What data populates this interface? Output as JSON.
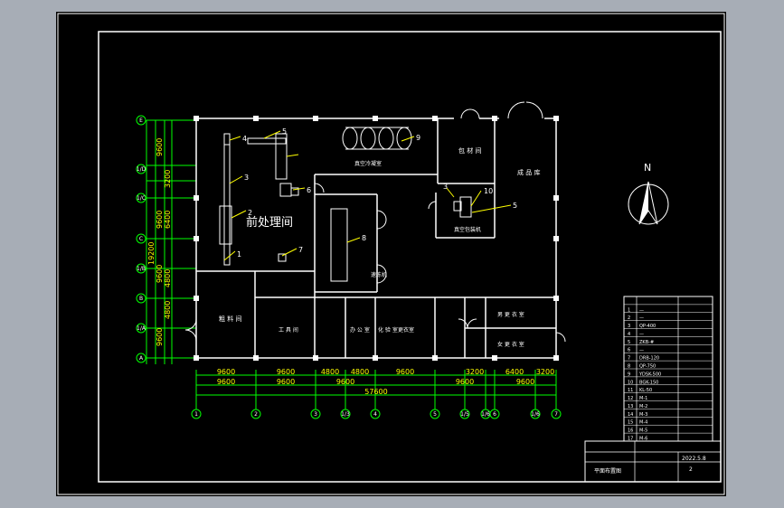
{
  "title_room": "前处理间",
  "rooms": {
    "roughing": "粗 料 间",
    "cold": "真空冷凝室",
    "pack": "包 材 间",
    "finished": "成 品 库",
    "packing": "真空包装机",
    "freezer": "速冻机",
    "tool": "工 具 间",
    "staff1": "办 公 室",
    "staff2": "化 验 室",
    "changing": "更衣室",
    "men": "男 更 衣 室",
    "women": "女 更 衣 室"
  },
  "tags": [
    "1",
    "2",
    "3",
    "4",
    "5",
    "6",
    "7",
    "8",
    "9",
    "10",
    "3",
    "5"
  ],
  "north": "N",
  "axes": {
    "x": [
      "1",
      "2",
      "3",
      "1/3",
      "4",
      "5",
      "1/5",
      "1/6",
      "6",
      "1/6",
      "7"
    ],
    "y": [
      "E",
      "1/D",
      "1/C",
      "C",
      "1/B",
      "B",
      "1/A",
      "A"
    ]
  },
  "dims": {
    "row1": [
      "9600",
      "9600",
      "4800",
      "4800",
      "9600",
      "3200",
      "6400",
      "3200"
    ],
    "row2": [
      "9600",
      "9600",
      "9600",
      "9600",
      "9600"
    ],
    "total": "57600",
    "left_col": [
      "9600",
      "3200",
      "9600",
      "6400",
      "9600",
      "4800",
      "4800",
      "9600"
    ],
    "left_total": "19200"
  },
  "legend": {
    "rows": [
      [
        "1",
        "—"
      ],
      [
        "2",
        "—"
      ],
      [
        "3",
        "QP-400"
      ],
      [
        "4",
        "—"
      ],
      [
        "5",
        "ZKB-#"
      ],
      [
        "6",
        "—"
      ],
      [
        "7",
        "DRB-120"
      ],
      [
        "8",
        "QP-750"
      ],
      [
        "9",
        "YDSK-500"
      ],
      [
        "10",
        "BGK-150"
      ],
      [
        "11",
        "KL-50"
      ],
      [
        "12",
        "M-1"
      ],
      [
        "13",
        "M-2"
      ],
      [
        "14",
        "M-3"
      ],
      [
        "15",
        "M-4"
      ],
      [
        "16",
        "M-5"
      ],
      [
        "17",
        "M-6"
      ]
    ]
  },
  "title_block": {
    "date": "2022.5.8",
    "page": "2",
    "caption": "平面布置图"
  },
  "colors": {
    "wall": "#ffffff",
    "axis": "#00ff00",
    "leader": "#ffff00",
    "frame": "#ffffff",
    "label": "#ffffff"
  }
}
